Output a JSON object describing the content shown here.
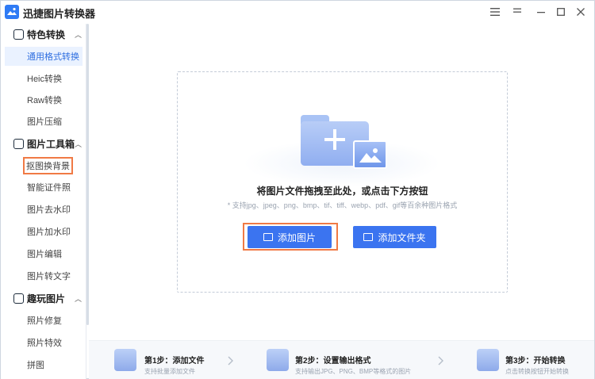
{
  "app": {
    "title": "迅捷图片转换器"
  },
  "window_controls": {
    "menu": "☰",
    "minimize": "—",
    "maximize": "☐",
    "close": "✕"
  },
  "sidebar": {
    "groups": [
      {
        "label": "特色转换",
        "icon": "special-convert-icon",
        "chevron": "︿",
        "items": [
          {
            "label": "通用格式转换",
            "active": true
          },
          {
            "label": "Heic转换"
          },
          {
            "label": "Raw转换"
          },
          {
            "label": "图片压缩"
          }
        ]
      },
      {
        "label": "图片工具箱",
        "icon": "toolbox-icon",
        "chevron": "︿",
        "items": [
          {
            "label": "抠图换背景",
            "highlighted": true
          },
          {
            "label": "智能证件照"
          },
          {
            "label": "图片去水印"
          },
          {
            "label": "图片加水印"
          },
          {
            "label": "图片编辑"
          },
          {
            "label": "图片转文字"
          }
        ]
      },
      {
        "label": "趣玩图片",
        "icon": "fun-image-icon",
        "chevron": "︿",
        "items": [
          {
            "label": "照片修复"
          },
          {
            "label": "照片特效"
          },
          {
            "label": "拼图"
          }
        ]
      }
    ]
  },
  "dropzone": {
    "title": "将图片文件拖拽至此处，或点击下方按钮",
    "subtitle": "* 支持jpg、jpeg、png、bmp、tif、tiff、webp、pdf、gif等百余种图片格式",
    "add_image_label": "添加图片",
    "add_folder_label": "添加文件夹"
  },
  "steps": [
    {
      "title": "第1步：添加文件",
      "desc": "支持批量添加文件",
      "icon": "add-file-icon"
    },
    {
      "title": "第2步：设置输出格式",
      "desc": "支持输出JPG、PNG、BMP等格式的图片",
      "icon": "settings-gear-icon"
    },
    {
      "title": "第3步：开始转换",
      "desc": "点击转换按钮开始转换",
      "icon": "convert-list-icon"
    }
  ],
  "colors": {
    "accent": "#3b74f0",
    "highlight": "#f07a45",
    "active_bg": "#eaf2ff"
  }
}
